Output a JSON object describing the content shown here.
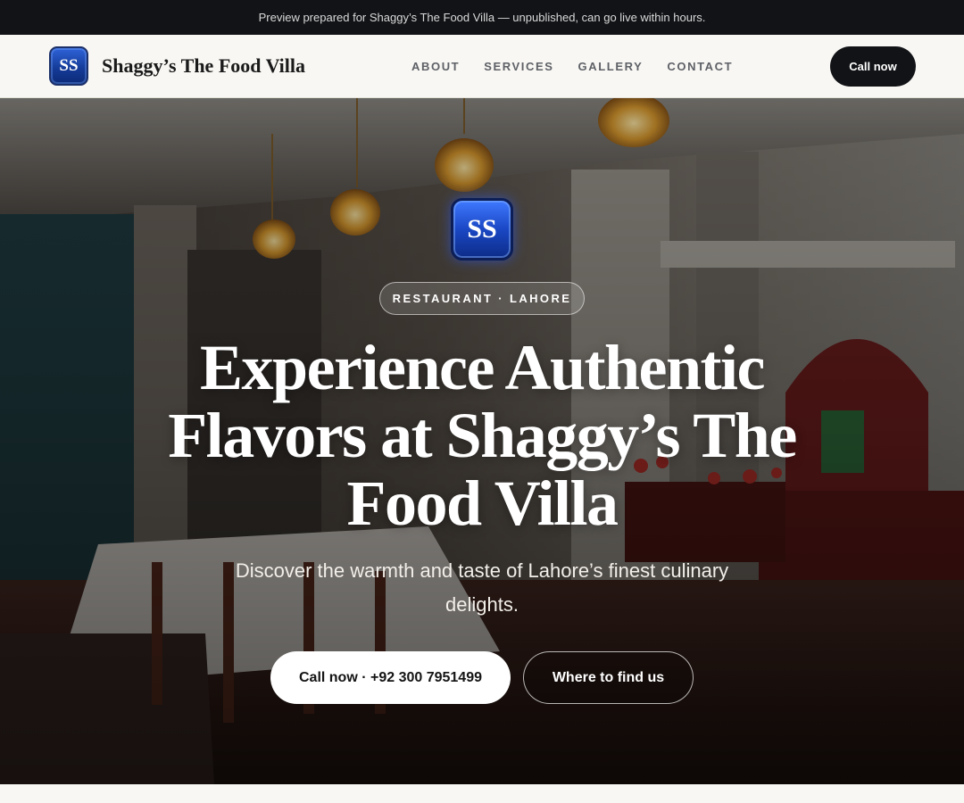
{
  "announcement": "Preview prepared for Shaggy’s The Food Villa — unpublished, can go live within hours.",
  "header": {
    "logo_initials": "SS",
    "brand_name": "Shaggy’s The Food Villa",
    "nav": [
      {
        "label": "ABOUT"
      },
      {
        "label": "SERVICES"
      },
      {
        "label": "GALLERY"
      },
      {
        "label": "CONTACT"
      }
    ],
    "cta_label": "Call now"
  },
  "hero": {
    "logo_initials": "SS",
    "tag": "RESTAURANT · LAHORE",
    "headline": "Experience Authentic Flavors at Shaggy’s The Food Villa",
    "subheadline": "Discover the warmth and taste of Lahore’s finest culinary delights.",
    "primary_button": "Call now · +92 300 7951499",
    "secondary_button": "Where to find us"
  },
  "colors": {
    "brand_blue": "#1a47c4",
    "dark": "#121317",
    "light_bg": "#f8f7f3"
  }
}
